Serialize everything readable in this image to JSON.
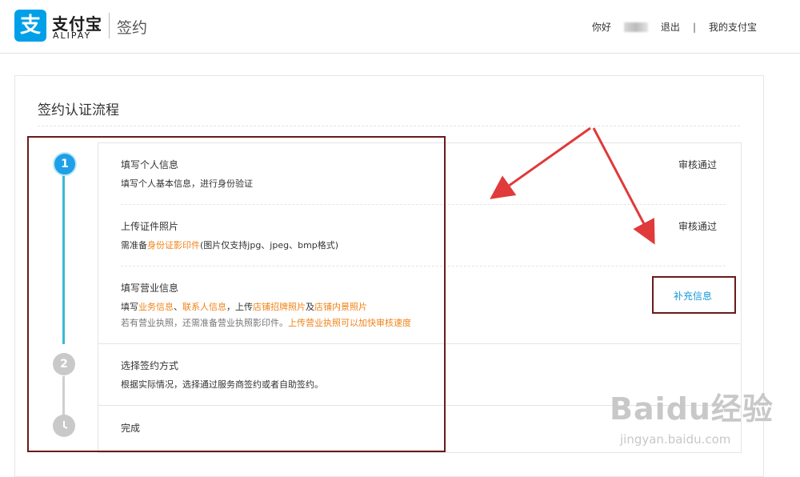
{
  "header": {
    "logo_char": "支",
    "brand_cn": "支付宝",
    "brand_en": "ALIPAY",
    "page_title": "签约",
    "greeting": "你好",
    "logout": "退出",
    "separator": "|",
    "my_alipay": "我的支付宝"
  },
  "card": {
    "title": "签约认证流程"
  },
  "steps": [
    {
      "number": "1",
      "title": "填写个人信息",
      "desc": "填写个人基本信息，进行身份验证",
      "status": "审核通过"
    },
    {
      "title": "上传证件照片",
      "desc_prefix": "需准备",
      "desc_link": "身份证影印件",
      "desc_suffix": "(图片仅支持jpg、jpeg、bmp格式)",
      "status": "审核通过"
    },
    {
      "title": "填写营业信息",
      "desc_prefix": "填写",
      "desc_link1": "业务信息",
      "desc_sep1": "、",
      "desc_link2": "联系人信息",
      "desc_mid": "，上传",
      "desc_link3": "店铺招牌照片",
      "desc_and": "及",
      "desc_link4": "店铺内景照片",
      "desc2_prefix": "若有营业执照，还需准备营业执照影印件。",
      "desc2_link": "上传营业执照可以加快审核速度",
      "action": "补充信息"
    },
    {
      "number": "2",
      "title": "选择签约方式",
      "desc": "根据实际情况，选择通过服务商签约或者自助签约。"
    },
    {
      "title": "完成"
    }
  ],
  "watermark": {
    "main": "Baidu经验",
    "sub": "jingyan.baidu.com"
  },
  "colors": {
    "brand_blue": "#00a0e9",
    "timeline_blue": "#3ab8d8",
    "link_orange": "#f08419",
    "link_blue": "#1a9ad8",
    "annotation": "#6a1a1a",
    "arrow_red": "#e03a3a"
  }
}
